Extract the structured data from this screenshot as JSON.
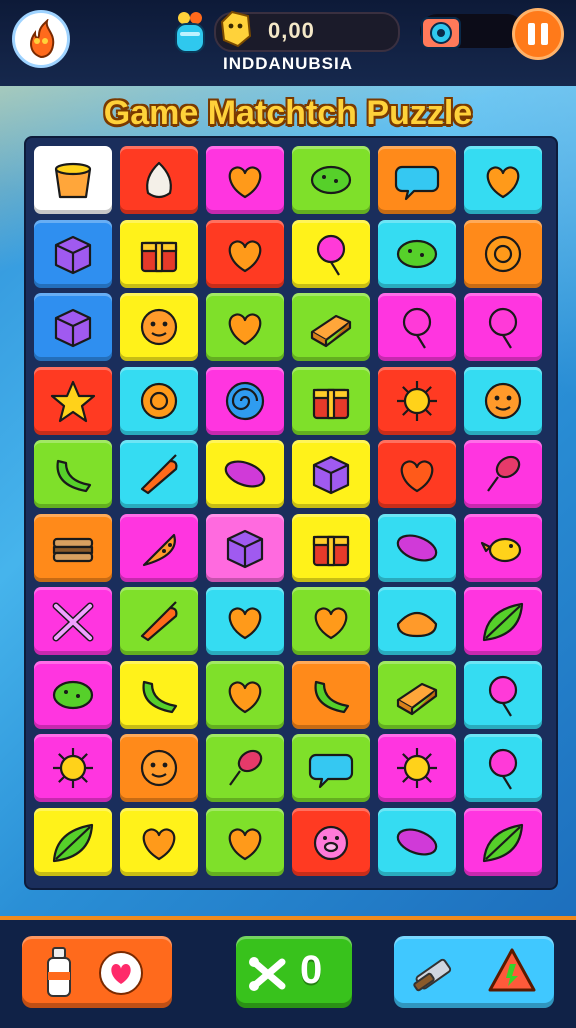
{
  "header": {
    "coins": "0,00",
    "region": "INDDANUBSIA",
    "avatar_icon": "flame-creature-icon",
    "cup_icon": "potion-cup-icon",
    "coin_icon": "gold-nugget-icon",
    "camera_icon": "camera-icon",
    "pause_icon": "pause-icon"
  },
  "title": "Game Matchtch Puzzle",
  "colors": {
    "red": "#ff3a22",
    "yellow": "#fff21a",
    "magenta": "#ff35e0",
    "green": "#7fe02a",
    "orange": "#ff8a1a",
    "cyan": "#35dcf2",
    "blue": "#2f8ff0",
    "white": "#ffffff",
    "pink": "#ff6adf",
    "lime": "#5fe03a",
    "violet": "#c63ae8",
    "teal": "#2ad8e6"
  },
  "board": {
    "rows": [
      [
        [
          "white",
          "cup-icon"
        ],
        [
          "red",
          "garlic-icon"
        ],
        [
          "magenta",
          "heart-icon"
        ],
        [
          "green",
          "bean-icon"
        ],
        [
          "orange",
          "speech-bubble-icon"
        ],
        [
          "cyan",
          "heart-candy-icon"
        ]
      ],
      [
        [
          "blue",
          "cube-icon"
        ],
        [
          "yellow",
          "gift-box-icon"
        ],
        [
          "red",
          "heart-icon"
        ],
        [
          "yellow",
          "dumbbell-candy-icon"
        ],
        [
          "cyan",
          "bean-icon"
        ],
        [
          "orange",
          "donut-icon"
        ]
      ],
      [
        [
          "blue",
          "sticker-box-icon"
        ],
        [
          "yellow",
          "cookie-icon"
        ],
        [
          "green",
          "heart-icon"
        ],
        [
          "green",
          "block-icon"
        ],
        [
          "magenta",
          "lollipop-icon"
        ],
        [
          "magenta",
          "balloon-icon"
        ]
      ],
      [
        [
          "red",
          "star-icon"
        ],
        [
          "cyan",
          "ring-icon"
        ],
        [
          "magenta",
          "swirl-candy-icon"
        ],
        [
          "green",
          "chest-icon"
        ],
        [
          "red",
          "sun-icon"
        ],
        [
          "cyan",
          "cookie-face-icon"
        ]
      ],
      [
        [
          "green",
          "phone-icon"
        ],
        [
          "cyan",
          "pepper-icon"
        ],
        [
          "yellow",
          "jellybean-icon"
        ],
        [
          "yellow",
          "cube-icon"
        ],
        [
          "red",
          "heart-blob-icon"
        ],
        [
          "magenta",
          "drumstick-icon"
        ]
      ],
      [
        [
          "orange",
          "sandwich-icon"
        ],
        [
          "magenta",
          "cookie-slice-icon"
        ],
        [
          "pink",
          "cube-icon"
        ],
        [
          "yellow",
          "oven-icon"
        ],
        [
          "cyan",
          "capsule-icon"
        ],
        [
          "magenta",
          "bird-icon"
        ]
      ],
      [
        [
          "magenta",
          "crossed-bones-icon"
        ],
        [
          "green",
          "carrot-icon"
        ],
        [
          "cyan",
          "heart-icon"
        ],
        [
          "green",
          "heart-icon"
        ],
        [
          "cyan",
          "bread-icon"
        ],
        [
          "magenta",
          "leaf-icon"
        ]
      ],
      [
        [
          "magenta",
          "pickle-icon"
        ],
        [
          "yellow",
          "banana-icon"
        ],
        [
          "green",
          "heart-icon"
        ],
        [
          "orange",
          "phone-icon"
        ],
        [
          "green",
          "block-icon"
        ],
        [
          "cyan",
          "lollipop-icon"
        ]
      ],
      [
        [
          "magenta",
          "sun-face-icon"
        ],
        [
          "orange",
          "face-icon"
        ],
        [
          "green",
          "popsicle-icon"
        ],
        [
          "green",
          "speech-bubble-icon"
        ],
        [
          "magenta",
          "gear-blob-icon"
        ],
        [
          "cyan",
          "lollipop-icon"
        ]
      ],
      [
        [
          "yellow",
          "leaf-icon"
        ],
        [
          "yellow",
          "heart-icon"
        ],
        [
          "green",
          "heart-icon"
        ],
        [
          "red",
          "pig-icon"
        ],
        [
          "cyan",
          "jellybean-icon"
        ],
        [
          "magenta",
          "surfboard-icon"
        ]
      ]
    ]
  },
  "footer": {
    "left_icon": "spray-bottle-icon",
    "left_badge_icon": "heart-badge-icon",
    "mid_icon": "shuffle-icon",
    "mid_count": "0",
    "right_icon": "hammer-icon",
    "right_icon2": "warning-triangle-icon"
  }
}
